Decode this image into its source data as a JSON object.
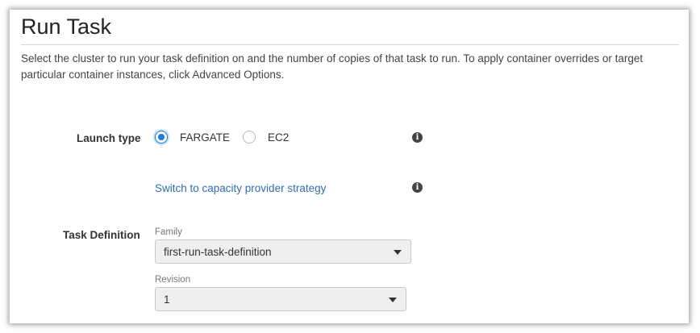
{
  "page": {
    "title": "Run Task",
    "description": "Select the cluster to run your task definition on and the number of copies of that task to run. To apply container overrides or target particular container instances, click Advanced Options."
  },
  "launch_type": {
    "label": "Launch type",
    "options": [
      {
        "label": "FARGATE",
        "selected": true
      },
      {
        "label": "EC2",
        "selected": false
      }
    ],
    "info_icon": "info-icon"
  },
  "capacity": {
    "link_label": "Switch to capacity provider strategy",
    "info_icon": "info-icon"
  },
  "task_definition": {
    "label": "Task Definition",
    "family": {
      "caption": "Family",
      "value": "first-run-task-definition"
    },
    "revision": {
      "caption": "Revision",
      "value": "1"
    }
  },
  "colors": {
    "accent": "#1d7ed6",
    "link": "#2f6eb5"
  }
}
